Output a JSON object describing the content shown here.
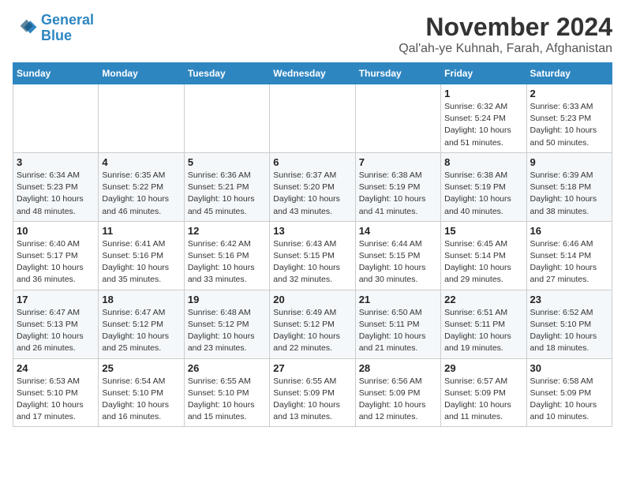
{
  "logo": {
    "line1": "General",
    "line2": "Blue"
  },
  "title": "November 2024",
  "subtitle": "Qal'ah-ye Kuhnah, Farah, Afghanistan",
  "weekdays": [
    "Sunday",
    "Monday",
    "Tuesday",
    "Wednesday",
    "Thursday",
    "Friday",
    "Saturday"
  ],
  "weeks": [
    [
      {
        "day": "",
        "info": ""
      },
      {
        "day": "",
        "info": ""
      },
      {
        "day": "",
        "info": ""
      },
      {
        "day": "",
        "info": ""
      },
      {
        "day": "",
        "info": ""
      },
      {
        "day": "1",
        "info": "Sunrise: 6:32 AM\nSunset: 5:24 PM\nDaylight: 10 hours and 51 minutes."
      },
      {
        "day": "2",
        "info": "Sunrise: 6:33 AM\nSunset: 5:23 PM\nDaylight: 10 hours and 50 minutes."
      }
    ],
    [
      {
        "day": "3",
        "info": "Sunrise: 6:34 AM\nSunset: 5:23 PM\nDaylight: 10 hours and 48 minutes."
      },
      {
        "day": "4",
        "info": "Sunrise: 6:35 AM\nSunset: 5:22 PM\nDaylight: 10 hours and 46 minutes."
      },
      {
        "day": "5",
        "info": "Sunrise: 6:36 AM\nSunset: 5:21 PM\nDaylight: 10 hours and 45 minutes."
      },
      {
        "day": "6",
        "info": "Sunrise: 6:37 AM\nSunset: 5:20 PM\nDaylight: 10 hours and 43 minutes."
      },
      {
        "day": "7",
        "info": "Sunrise: 6:38 AM\nSunset: 5:19 PM\nDaylight: 10 hours and 41 minutes."
      },
      {
        "day": "8",
        "info": "Sunrise: 6:38 AM\nSunset: 5:19 PM\nDaylight: 10 hours and 40 minutes."
      },
      {
        "day": "9",
        "info": "Sunrise: 6:39 AM\nSunset: 5:18 PM\nDaylight: 10 hours and 38 minutes."
      }
    ],
    [
      {
        "day": "10",
        "info": "Sunrise: 6:40 AM\nSunset: 5:17 PM\nDaylight: 10 hours and 36 minutes."
      },
      {
        "day": "11",
        "info": "Sunrise: 6:41 AM\nSunset: 5:16 PM\nDaylight: 10 hours and 35 minutes."
      },
      {
        "day": "12",
        "info": "Sunrise: 6:42 AM\nSunset: 5:16 PM\nDaylight: 10 hours and 33 minutes."
      },
      {
        "day": "13",
        "info": "Sunrise: 6:43 AM\nSunset: 5:15 PM\nDaylight: 10 hours and 32 minutes."
      },
      {
        "day": "14",
        "info": "Sunrise: 6:44 AM\nSunset: 5:15 PM\nDaylight: 10 hours and 30 minutes."
      },
      {
        "day": "15",
        "info": "Sunrise: 6:45 AM\nSunset: 5:14 PM\nDaylight: 10 hours and 29 minutes."
      },
      {
        "day": "16",
        "info": "Sunrise: 6:46 AM\nSunset: 5:14 PM\nDaylight: 10 hours and 27 minutes."
      }
    ],
    [
      {
        "day": "17",
        "info": "Sunrise: 6:47 AM\nSunset: 5:13 PM\nDaylight: 10 hours and 26 minutes."
      },
      {
        "day": "18",
        "info": "Sunrise: 6:47 AM\nSunset: 5:12 PM\nDaylight: 10 hours and 25 minutes."
      },
      {
        "day": "19",
        "info": "Sunrise: 6:48 AM\nSunset: 5:12 PM\nDaylight: 10 hours and 23 minutes."
      },
      {
        "day": "20",
        "info": "Sunrise: 6:49 AM\nSunset: 5:12 PM\nDaylight: 10 hours and 22 minutes."
      },
      {
        "day": "21",
        "info": "Sunrise: 6:50 AM\nSunset: 5:11 PM\nDaylight: 10 hours and 21 minutes."
      },
      {
        "day": "22",
        "info": "Sunrise: 6:51 AM\nSunset: 5:11 PM\nDaylight: 10 hours and 19 minutes."
      },
      {
        "day": "23",
        "info": "Sunrise: 6:52 AM\nSunset: 5:10 PM\nDaylight: 10 hours and 18 minutes."
      }
    ],
    [
      {
        "day": "24",
        "info": "Sunrise: 6:53 AM\nSunset: 5:10 PM\nDaylight: 10 hours and 17 minutes."
      },
      {
        "day": "25",
        "info": "Sunrise: 6:54 AM\nSunset: 5:10 PM\nDaylight: 10 hours and 16 minutes."
      },
      {
        "day": "26",
        "info": "Sunrise: 6:55 AM\nSunset: 5:10 PM\nDaylight: 10 hours and 15 minutes."
      },
      {
        "day": "27",
        "info": "Sunrise: 6:55 AM\nSunset: 5:09 PM\nDaylight: 10 hours and 13 minutes."
      },
      {
        "day": "28",
        "info": "Sunrise: 6:56 AM\nSunset: 5:09 PM\nDaylight: 10 hours and 12 minutes."
      },
      {
        "day": "29",
        "info": "Sunrise: 6:57 AM\nSunset: 5:09 PM\nDaylight: 10 hours and 11 minutes."
      },
      {
        "day": "30",
        "info": "Sunrise: 6:58 AM\nSunset: 5:09 PM\nDaylight: 10 hours and 10 minutes."
      }
    ]
  ]
}
